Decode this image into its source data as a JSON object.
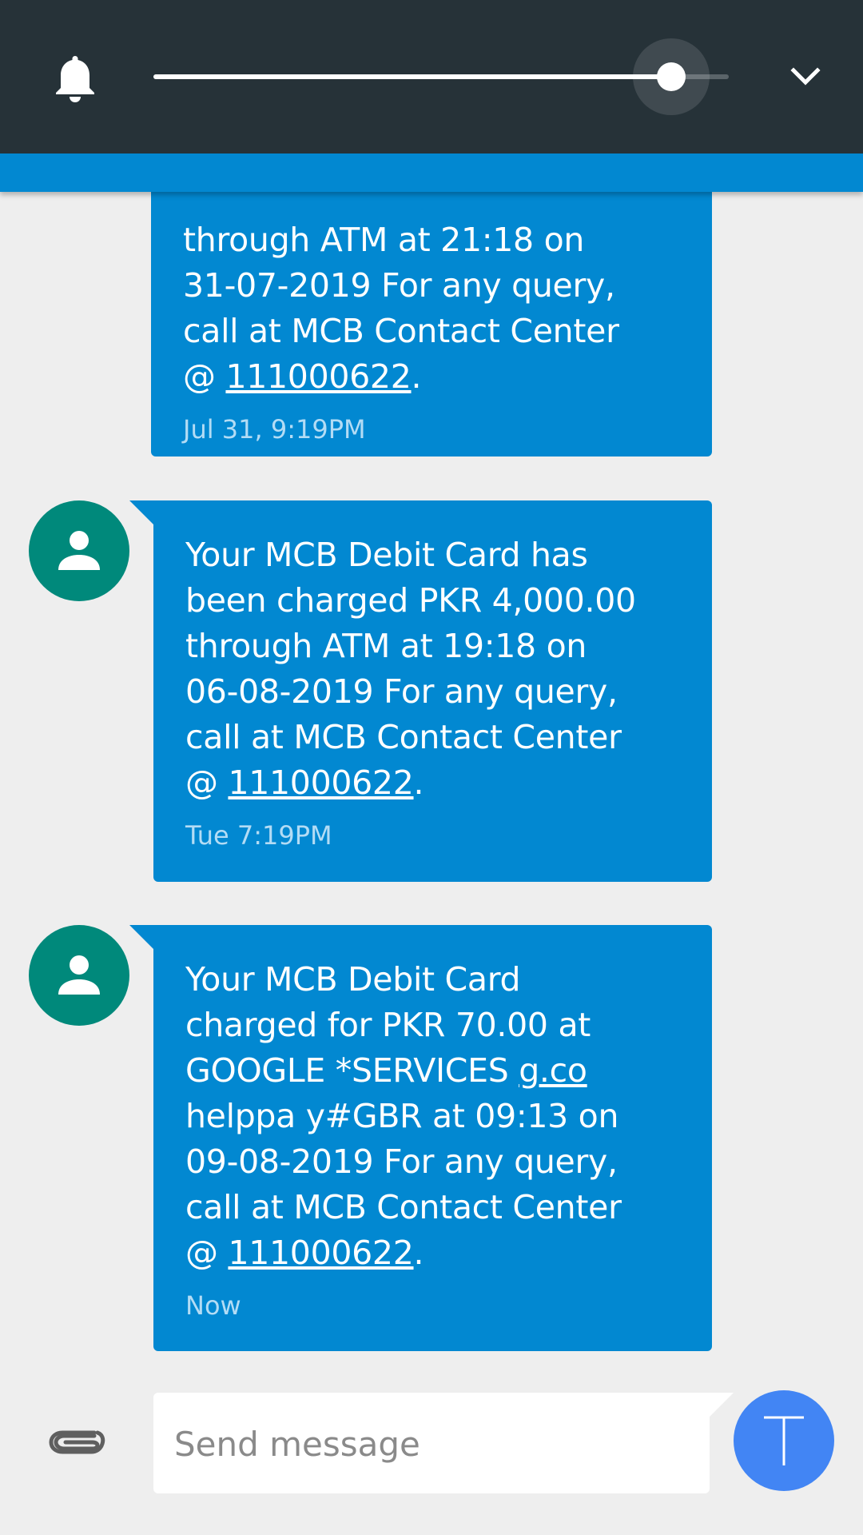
{
  "volume": {
    "level": 0.9,
    "icons": {
      "ringer": "bell-icon",
      "expand": "chevron-down-icon"
    }
  },
  "messages": [
    {
      "text_before": "through ATM at 21:18 on\n31-07-2019 For any query,\ncall at MCB Contact Center\n@ ",
      "link": "111000622",
      "text_after": ".",
      "time": "Jul 31, 9:19PM"
    },
    {
      "text_before": "Your MCB Debit Card has\nbeen charged PKR 4,000.00\nthrough ATM at 19:18 on\n06-08-2019 For any query,\ncall at MCB Contact Center\n@ ",
      "link": "111000622",
      "text_after": ".",
      "time": "Tue 7:19PM"
    },
    {
      "text_before": "Your MCB Debit Card\ncharged for PKR 70.00 at\nGOOGLE *SERVICES ",
      "link_inline": "g.co",
      "text_middle": "\nhelppa y#GBR at 09:13 on\n09-08-2019 For any query,\ncall at MCB Contact Center\n@ ",
      "link": "111000622",
      "text_after": ".",
      "time": "Now"
    }
  ],
  "compose": {
    "placeholder": "Send message",
    "icons": {
      "attach": "paperclip-icon",
      "send": "send-icon"
    }
  },
  "colors": {
    "panel": "#263238",
    "bubble": "#0288d1",
    "avatar": "#00897b",
    "send": "#4285f4",
    "background": "#eeeeee"
  }
}
